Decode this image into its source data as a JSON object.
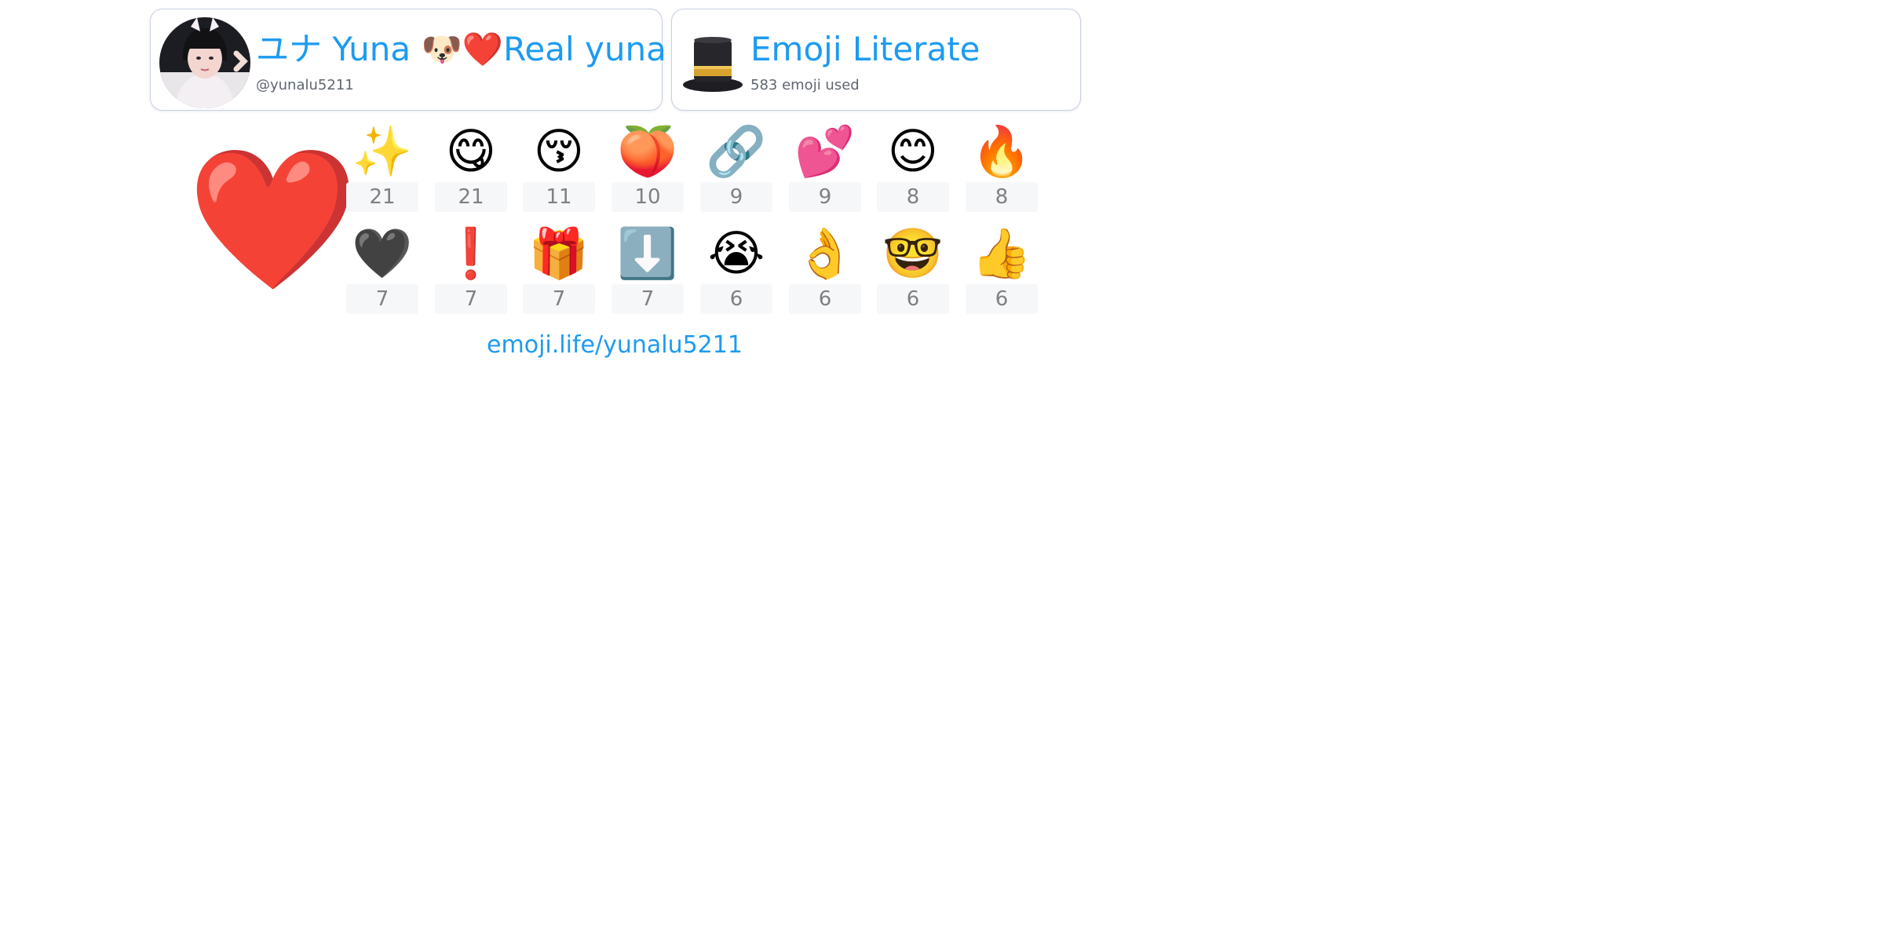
{
  "profile": {
    "name": "ユナ Yuna 🐶❤️Real yuna",
    "handle": "@yunalu5211"
  },
  "badge": {
    "title": "Emoji Literate",
    "subtitle": "583 emoji used",
    "icon": "top-hat-icon"
  },
  "top_emoji": {
    "emoji": "❤️",
    "icon": "red-heart-icon"
  },
  "emoji_stats": [
    {
      "emoji": "✨",
      "count": "21",
      "icon": "sparkles-icon"
    },
    {
      "emoji": "😋",
      "count": "21",
      "icon": "yum-face-icon"
    },
    {
      "emoji": "😚",
      "count": "11",
      "icon": "kissing-face-icon"
    },
    {
      "emoji": "🍑",
      "count": "10",
      "icon": "peach-icon"
    },
    {
      "emoji": "🔗",
      "count": "9",
      "icon": "link-icon"
    },
    {
      "emoji": "💕",
      "count": "9",
      "icon": "two-hearts-icon"
    },
    {
      "emoji": "😊",
      "count": "8",
      "icon": "smiling-face-icon"
    },
    {
      "emoji": "🔥",
      "count": "8",
      "icon": "fire-icon"
    },
    {
      "emoji": "🖤",
      "count": "7",
      "icon": "black-heart-icon"
    },
    {
      "emoji": "❗",
      "count": "7",
      "icon": "exclamation-icon"
    },
    {
      "emoji": "🎁",
      "count": "7",
      "icon": "gift-icon"
    },
    {
      "emoji": "⬇️",
      "count": "7",
      "icon": "down-arrow-icon"
    },
    {
      "emoji": "😭",
      "count": "6",
      "icon": "crying-face-icon"
    },
    {
      "emoji": "👌",
      "count": "6",
      "icon": "ok-hand-icon"
    },
    {
      "emoji": "🤓",
      "count": "6",
      "icon": "nerd-face-icon"
    },
    {
      "emoji": "👍",
      "count": "6",
      "icon": "thumbs-up-icon"
    }
  ],
  "footer": {
    "link": "emoji.life/yunalu5211"
  },
  "colors": {
    "accent": "#1d9bf0",
    "muted_text": "#5f6670",
    "count_text": "#808080",
    "count_bg": "#f6f7f9",
    "card_border": "#c9d0e3"
  }
}
